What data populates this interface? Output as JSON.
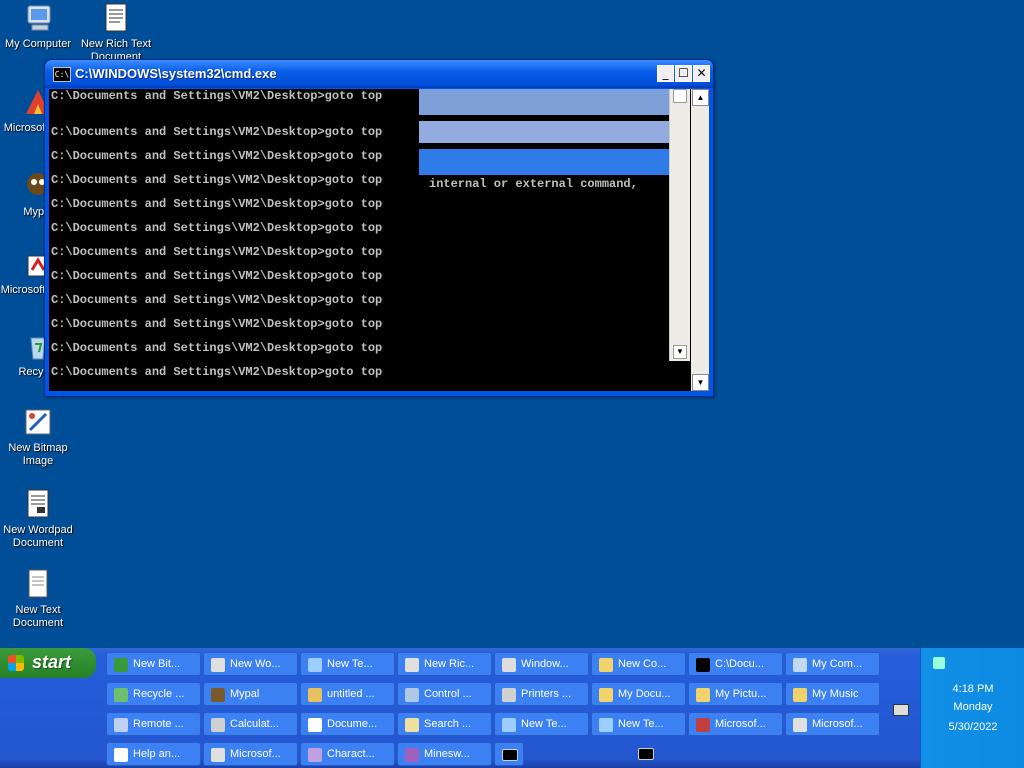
{
  "desktop": {
    "icons": [
      {
        "label": "My Computer",
        "icon": "computer-icon"
      },
      {
        "label": "New Rich Text Document",
        "icon": "document-icon"
      },
      {
        "label": "Microsoft C++",
        "icon": "msvc-icon"
      },
      {
        "label": "Mypal",
        "icon": "mypal-icon"
      },
      {
        "label": "Microsoft Basic",
        "icon": "basic-icon"
      },
      {
        "label": "Recycle",
        "icon": "recycle-bin-icon"
      },
      {
        "label": "New Bitmap Image",
        "icon": "bitmap-icon"
      },
      {
        "label": "New Wordpad Document",
        "icon": "wordpad-icon"
      },
      {
        "label": "New Text Document",
        "icon": "text-document-icon"
      }
    ]
  },
  "window": {
    "title": "C:\\WINDOWS\\system32\\cmd.exe",
    "app_icon_text": "C:\\",
    "minimize": "_",
    "maximize": "☐",
    "close": "✕",
    "lines": [
      "C:\\Documents and Settings\\VM2\\Desktop>goto top",
      "",
      "C:\\Documents and Settings\\VM2\\Desktop>goto top",
      "C:\\Documents and Settings\\VM2\\Desktop>goto top",
      "C:\\Documents and Settings\\VM2\\Desktop>goto top",
      "C:\\Documents and Settings\\VM2\\Desktop>goto top",
      "C:\\Documents and Settings\\VM2\\Desktop>goto top",
      "C:\\Documents and Settings\\VM2\\Desktop>goto top",
      "C:\\Documents and Settings\\VM2\\Desktop>goto top",
      "C:\\Documents and Settings\\VM2\\Desktop>goto top",
      "C:\\Documents and Settings\\VM2\\Desktop>goto top",
      "C:\\Documents and Settings\\VM2\\Desktop>goto top",
      "C:\\Documents and Settings\\VM2\\Desktop>goto top"
    ],
    "ghost_text": "internal or external command,",
    "scroll_up": "▲",
    "scroll_down": "▼"
  },
  "taskbar": {
    "start_label": "start",
    "rows": [
      [
        {
          "label": "New Bit...",
          "icon": "bitmap-icon",
          "color": "#3a9a3a"
        },
        {
          "label": "New Wo...",
          "icon": "wordpad-icon",
          "color": "#e0e0e0"
        },
        {
          "label": "New Te...",
          "icon": "notepad-icon",
          "color": "#9ccfff"
        },
        {
          "label": "New Ric...",
          "icon": "wordpad-icon",
          "color": "#e0e0e0"
        },
        {
          "label": "Window...",
          "icon": "media-player-icon",
          "color": "#dddddd"
        },
        {
          "label": "New Co...",
          "icon": "folder-icon",
          "color": "#f1d36a"
        },
        {
          "label": "C:\\Docu...",
          "icon": "7zip-icon",
          "color": "#000000"
        },
        {
          "label": "My Com...",
          "icon": "computer-icon",
          "color": "#c0d8f0"
        }
      ],
      [
        {
          "label": "Recycle ...",
          "icon": "recycle-bin-icon",
          "color": "#6fbf6f"
        },
        {
          "label": "Mypal",
          "icon": "mypal-icon",
          "color": "#7a5a2a"
        },
        {
          "label": "untitled ...",
          "icon": "paint-icon",
          "color": "#e8c060"
        },
        {
          "label": "Control ...",
          "icon": "control-panel-icon",
          "color": "#b0c8e8"
        },
        {
          "label": "Printers ...",
          "icon": "printer-icon",
          "color": "#d0d0d0"
        },
        {
          "label": "My Docu...",
          "icon": "folder-icon",
          "color": "#f1d36a"
        },
        {
          "label": "My Pictu...",
          "icon": "folder-icon",
          "color": "#f1d36a"
        },
        {
          "label": "My Music",
          "icon": "folder-icon",
          "color": "#f1d36a"
        }
      ],
      [
        {
          "label": "Remote ...",
          "icon": "remote-desktop-icon",
          "color": "#c0d0f0"
        },
        {
          "label": "Calculat...",
          "icon": "calculator-icon",
          "color": "#d0d0d0"
        },
        {
          "label": "Docume...",
          "icon": "document-icon",
          "color": "#ffffff"
        },
        {
          "label": "Search ...",
          "icon": "search-icon",
          "color": "#f0e0a0"
        },
        {
          "label": "New Te...",
          "icon": "notepad-icon",
          "color": "#9ccfff"
        },
        {
          "label": "New Te...",
          "icon": "notepad-icon",
          "color": "#9ccfff"
        },
        {
          "label": "Microsof...",
          "icon": "msvc-icon",
          "color": "#c04040"
        },
        {
          "label": "Microsof...",
          "icon": "basic-icon",
          "color": "#e0e0e0"
        }
      ],
      [
        {
          "label": "Help an...",
          "icon": "help-icon",
          "color": "#ffffff"
        },
        {
          "label": "Microsof...",
          "icon": "app-icon",
          "color": "#e0e0e0"
        },
        {
          "label": "Charact...",
          "icon": "character-map-icon",
          "color": "#c0a0e0"
        },
        {
          "label": "Minesw...",
          "icon": "minesweeper-icon",
          "color": "#a060c0"
        },
        {
          "label": "",
          "icon": "cmd-icon",
          "color": "#000000"
        },
        {
          "label": "",
          "icon": "cmd-icon",
          "color": "#000000"
        }
      ]
    ],
    "clock": {
      "time": "4:18 PM",
      "day": "Monday",
      "date": "5/30/2022"
    }
  }
}
